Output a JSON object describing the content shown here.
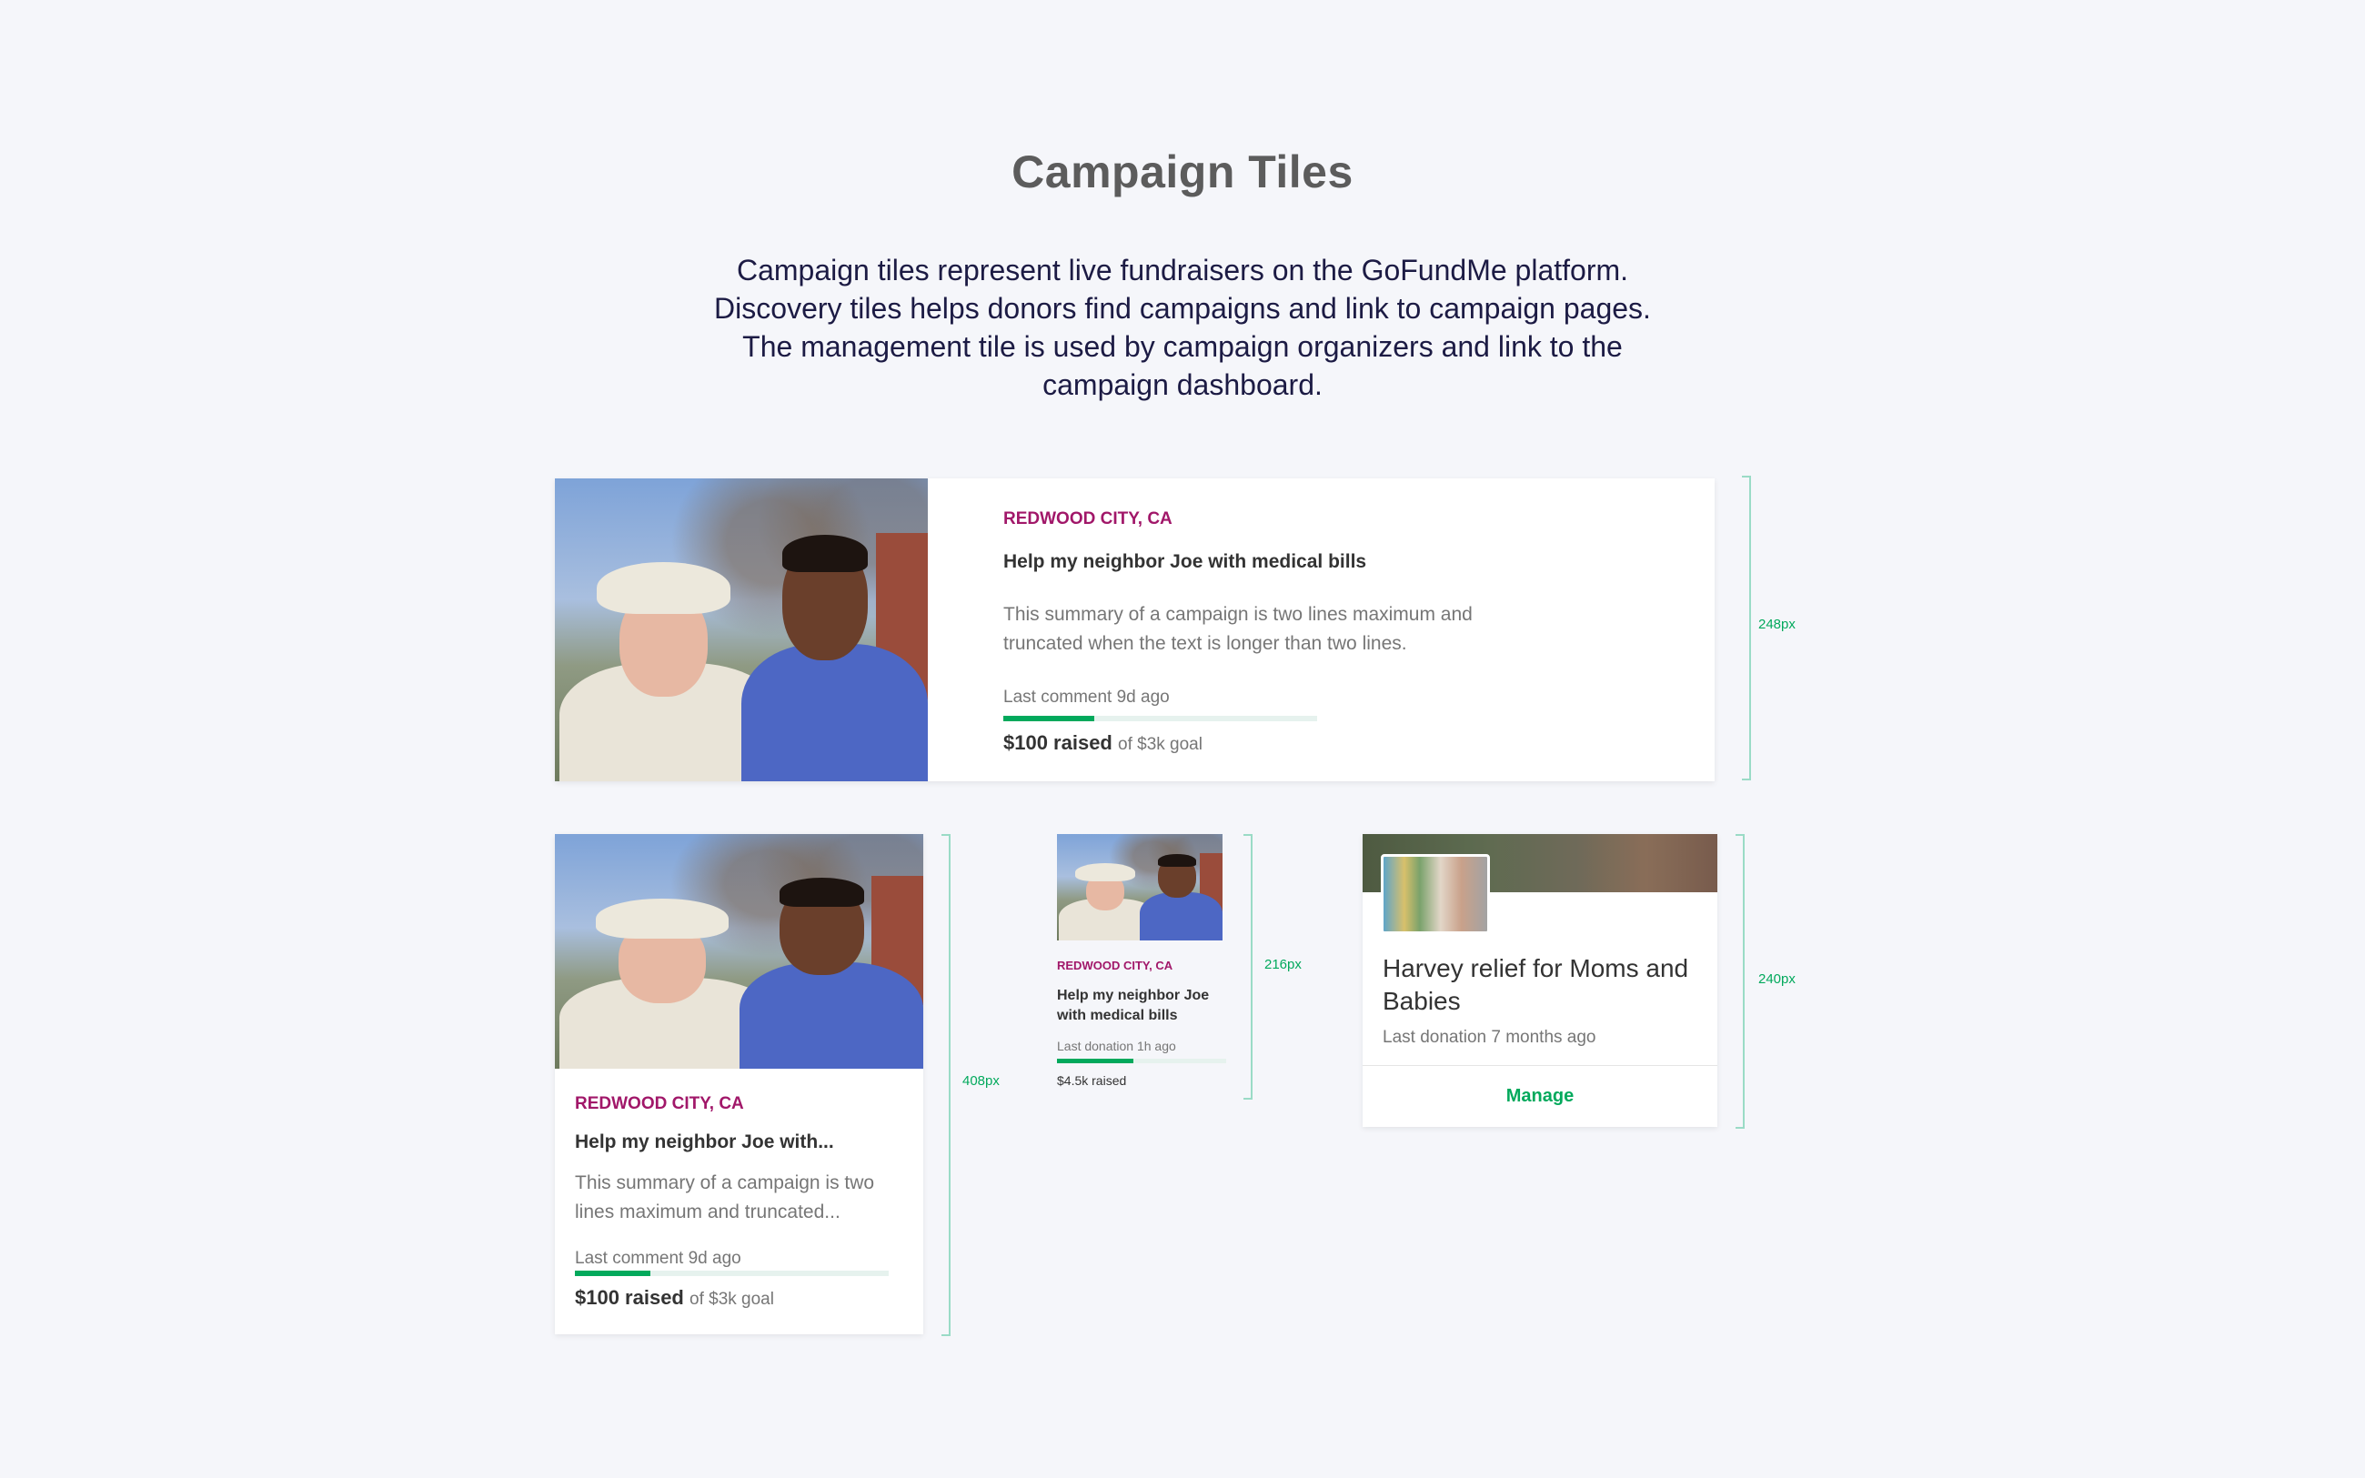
{
  "header": {
    "title": "Campaign Tiles",
    "intro": "Campaign tiles represent live fundraisers on the GoFundMe platform. Discovery tiles helps donors find campaigns and link to campaign pages. The management tile is used by campaign organizers and link to the campaign dashboard."
  },
  "tiles": {
    "large": {
      "location": "REDWOOD CITY, CA",
      "title": "Help my neighbor Joe with medical bills",
      "summary": "This summary of a campaign is two lines maximum and truncated when the text is longer than two lines.",
      "meta": "Last comment 9d ago",
      "progress": 0.29,
      "raised": "$100 raised",
      "goal": "of $3k goal",
      "height_label": "248px"
    },
    "medium": {
      "location": "REDWOOD CITY, CA",
      "title": "Help my neighbor Joe with...",
      "summary": "This summary of a campaign is two lines maximum and truncated...",
      "meta": "Last comment 9d ago",
      "progress": 0.24,
      "raised": "$100 raised",
      "goal": "of $3k goal",
      "height_label": "408px"
    },
    "small": {
      "location": "REDWOOD CITY, CA",
      "title": "Help my neighbor Joe with medical bills",
      "meta": "Last donation 1h ago",
      "progress": 0.45,
      "raised": "$4.5k raised",
      "height_label": "216px"
    },
    "manage": {
      "title": "Harvey relief for Moms and Babies",
      "meta": "Last donation 7 months ago",
      "button": "Manage",
      "height_label": "240px"
    }
  },
  "colors": {
    "background": "#f5f6fa",
    "location": "#a11769",
    "accent_green": "#02a95c",
    "title_gray": "#5c5c5c",
    "intro_navy": "#1c1b44"
  }
}
